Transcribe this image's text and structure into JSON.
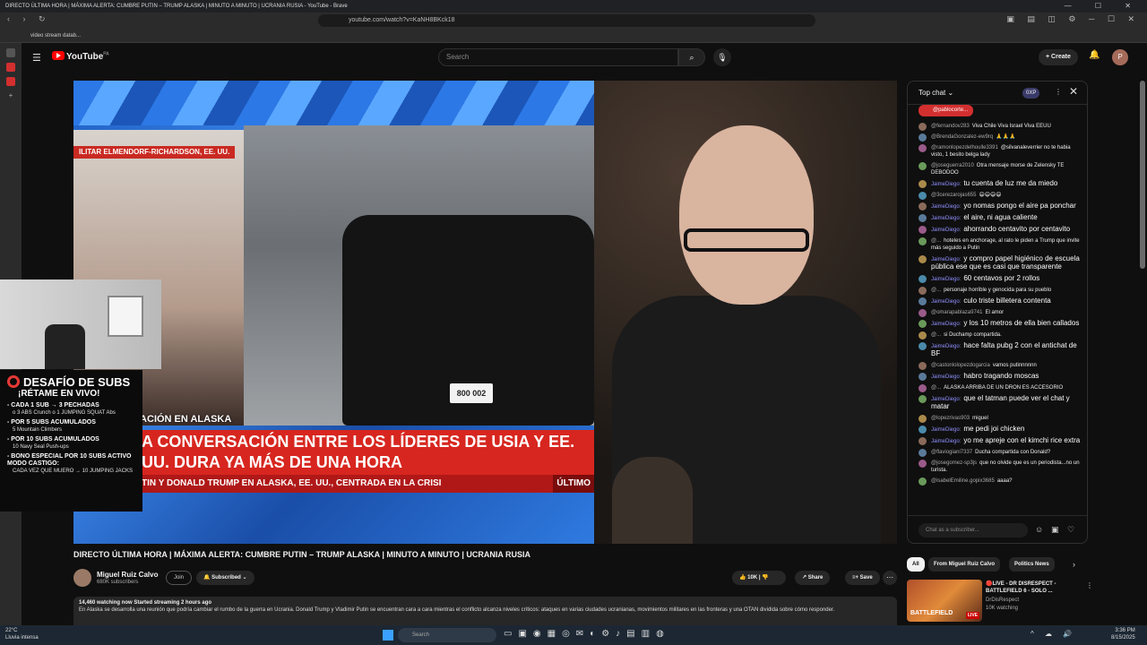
{
  "window": {
    "title": "DIRECTO ÚLTIMA HORA | MÁXIMA ALERTA: CUMBRE PUTIN – TRUMP ALASKA | MINUTO A MINUTO | UCRANIA RUSIA - YouTube - Brave",
    "url": "youtube.com/watch?v=KaNH8BKck18",
    "bookmark": "video stream datab..."
  },
  "header": {
    "logo_text": "YouTube",
    "logo_region": "PA",
    "search_placeholder": "Search",
    "create_label": "Create",
    "avatar_letter": "P"
  },
  "news": {
    "location_tag": "ILITAR ELMENDORF-RICHARDSON, EE. UU.",
    "band_label": "LEACIÓN EN ALASKA",
    "headline": "A CONVERSACIÓN ENTRE LOS LÍDERES DE USIA Y EE. UU. DURA YA MÁS DE UNA HORA",
    "ticker": "TIN Y DONALD TRUMP EN ALASKA, EE. UU., CENTRADA EN LA CRISI",
    "ticker_tag": "ÚLTIMO",
    "plate": "800 002"
  },
  "challenge": {
    "title": "DESAFÍO DE SUBS",
    "subtitle": "¡RÉTAME EN VIVO!",
    "rules": [
      {
        "head": "- CADA 1 SUB → 3 PECHADAS",
        "detail": "o 3 ABS Crunch o 1 JUMPING SQUAT Abs"
      },
      {
        "head": "- POR 5 SUBS ACUMULADOS",
        "detail": "5 Mountain Climbers"
      },
      {
        "head": "- POR 10 SUBS ACUMULADOS",
        "detail": "10 Navy Seal Push-ups"
      },
      {
        "head": "- BONO ESPECIAL POR 10 SUBS ACTIVO MODO CASTIGO:",
        "detail": "CADA VEZ QUE MUERO → 10 JUMPING JACKS"
      }
    ]
  },
  "video": {
    "title": "DIRECTO ÚLTIMA HORA | MÁXIMA ALERTA: CUMBRE PUTIN – TRUMP ALASKA | MINUTO A MINUTO | UCRANIA RUSIA",
    "channel": "Miguel Ruiz Calvo",
    "subscribers": "680K subscribers",
    "join_label": "Join",
    "subscribed_label": "Subscribed",
    "likes": "10K",
    "share_label": "Share",
    "save_label": "Save",
    "meta": "14,460 watching now  Started streaming 2 hours ago",
    "description": "En Alaska se desarrolla una reunión que podría cambiar el rumbo de la guerra en Ucrania. Donald Trump y Vladimir Putin se encuentran cara a cara mientras el conflicto alcanza niveles críticos: ataques en varias ciudades ucranianas, movimientos militares en las fronteras y una OTAN dividida sobre cómo responder."
  },
  "chat": {
    "mode": "Top chat",
    "xp": "0XP",
    "pinned": "@pablocorte...",
    "messages": [
      {
        "user": "@fernandov283",
        "text": "Viva Chile Viva Israel Viva EEUU",
        "highlight": false
      },
      {
        "user": "@BrendaGonzalez-ew9rq",
        "text": "🙏🙏🙏",
        "highlight": false
      },
      {
        "user": "@ramonlopezdelhoulle3391",
        "text": "@silvanaleverrier no te habia visto, 1 besito belga lady",
        "highlight": false
      },
      {
        "user": "@joseguerra2010",
        "text": "Otra mensaje morse de Zelensky TE DEBODOO",
        "highlight": false
      },
      {
        "user": "JaimeDiego:",
        "text": "tu cuenta de luz me da miedo",
        "highlight": true
      },
      {
        "user": "@3cerezarojas655",
        "text": "😄😄😄😄",
        "highlight": false
      },
      {
        "user": "JaimeDiego:",
        "text": "yo nomas pongo el aire pa ponchar",
        "highlight": true
      },
      {
        "user": "JaimeDiego:",
        "text": "el aire, ni agua caliente",
        "highlight": true
      },
      {
        "user": "JaimeDiego:",
        "text": "ahorrando centavito por centavito",
        "highlight": true
      },
      {
        "user": "@...",
        "text": "hoteles en anchorage, al rato le piden a Trump que invite más seguido a Putin",
        "highlight": false
      },
      {
        "user": "JaimeDiego:",
        "text": "y compro papel higiénico de escuela pública ese que es casi que transparente",
        "highlight": true
      },
      {
        "user": "JaimeDiego:",
        "text": "60 centavos por 2 rollos",
        "highlight": true
      },
      {
        "user": "@...",
        "text": "personaje horrible y genocida para su pueblo",
        "highlight": false
      },
      {
        "user": "JaimeDiego:",
        "text": "culo triste billetera contenta",
        "highlight": true
      },
      {
        "user": "@omarapablaza9741",
        "text": "El amor",
        "highlight": false
      },
      {
        "user": "JaimeDiego:",
        "text": "y los 10 metros de ella bien callados",
        "highlight": true
      },
      {
        "user": "@...",
        "text": "si Duchamp compartida.",
        "highlight": false
      },
      {
        "user": "JaimeDiego:",
        "text": "hace falta pubg 2 con el antichat de BF",
        "highlight": true
      },
      {
        "user": "@castonlolopezdogarcia",
        "text": "vamos putinnnnnn",
        "highlight": false
      },
      {
        "user": "JaimeDiego:",
        "text": "habro tragando moscas",
        "highlight": true
      },
      {
        "user": "@...",
        "text": "ALASKA ARRIBA DE UN DRON ES ACCESORIO",
        "highlight": false
      },
      {
        "user": "JaimeDiego:",
        "text": "que el tatman puede ver el chat y matar",
        "highlight": true
      },
      {
        "user": "@lopezrivas903",
        "text": "miguel",
        "highlight": false
      },
      {
        "user": "JaimeDiego:",
        "text": "me pedi joi chicken",
        "highlight": true
      },
      {
        "user": "JaimeDiego:",
        "text": "yo me apreje con el kimchi rice extra",
        "highlight": true
      },
      {
        "user": "@flaviogiani7337",
        "text": "Ducha compartida con Donald?",
        "highlight": false
      },
      {
        "user": "@josegomez-sp3js",
        "text": "que no olvide que es un periodista...no un turista.",
        "highlight": false
      },
      {
        "user": "@isabelEmiline.gopix3685",
        "text": "aaaa?",
        "highlight": false
      }
    ],
    "input_placeholder": "Chat as a subscriber..."
  },
  "chips": [
    "All",
    "From Miguel Ruiz Calvo",
    "Politics News"
  ],
  "recommended": {
    "title": "🔴LIVE - DR DISRESPECT - BATTLEFIELD 6 - SOLO ...",
    "channel": "DrDisRespect",
    "viewers": "10K watching",
    "thumb_text": "BATTLEFIELD",
    "live_badge": "LIVE"
  },
  "taskbar": {
    "temp": "22°C",
    "weather": "Lluvia intensa",
    "search_placeholder": "Search",
    "time": "3:36 PM",
    "date": "8/15/2025"
  }
}
